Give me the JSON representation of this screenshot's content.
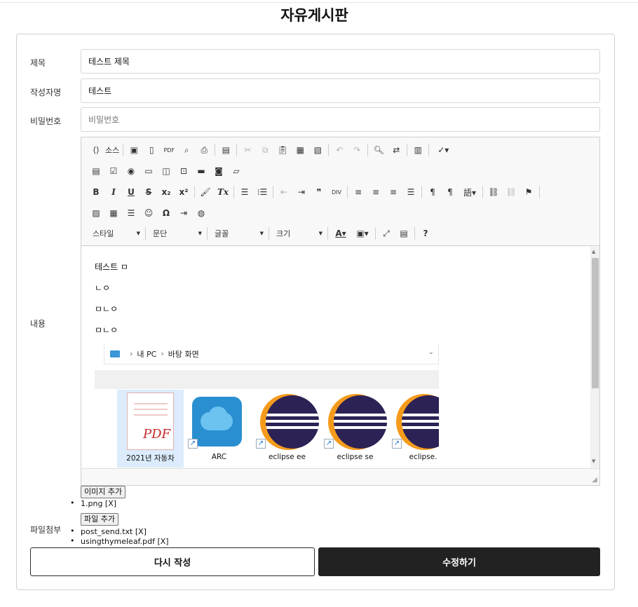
{
  "page": {
    "title": "자유게시판"
  },
  "form": {
    "title_label": "제목",
    "title_value": "테스트 제목",
    "author_label": "작성자명",
    "author_value": "테스트",
    "password_label": "비밀번호",
    "password_placeholder": "비밀번호",
    "content_label": "내용",
    "file_label": "파일첨부"
  },
  "editor": {
    "source_label": "소스",
    "combos": [
      {
        "label": "스타일"
      },
      {
        "label": "문단"
      },
      {
        "label": "글꼴"
      },
      {
        "label": "크기"
      }
    ],
    "content_lines": [
      "테스트 ㅁ",
      "ㄴㅇ",
      "ㅁㄴㅇ",
      "ㅁㄴㅇ"
    ],
    "embedded_image": {
      "breadcrumb": [
        "내 PC",
        "바탕 화면"
      ],
      "files": [
        {
          "name": "2021년 자동차",
          "icon": "pdf-file-icon"
        },
        {
          "name": "ARC",
          "icon": "arc-cloud-icon"
        },
        {
          "name": "eclipse ee",
          "icon": "eclipse-icon"
        },
        {
          "name": "eclipse se",
          "icon": "eclipse-icon"
        },
        {
          "name": "eclipse.",
          "icon": "eclipse-icon"
        }
      ]
    }
  },
  "attachments": {
    "image_add_label": "이미지 추가",
    "images": [
      "1.png [X]"
    ],
    "file_add_label": "파일 추가",
    "files": [
      "post_send.txt [X]",
      "usingthymeleaf.pdf [X]"
    ]
  },
  "actions": {
    "reset_label": "다시 작성",
    "submit_label": "수정하기"
  }
}
